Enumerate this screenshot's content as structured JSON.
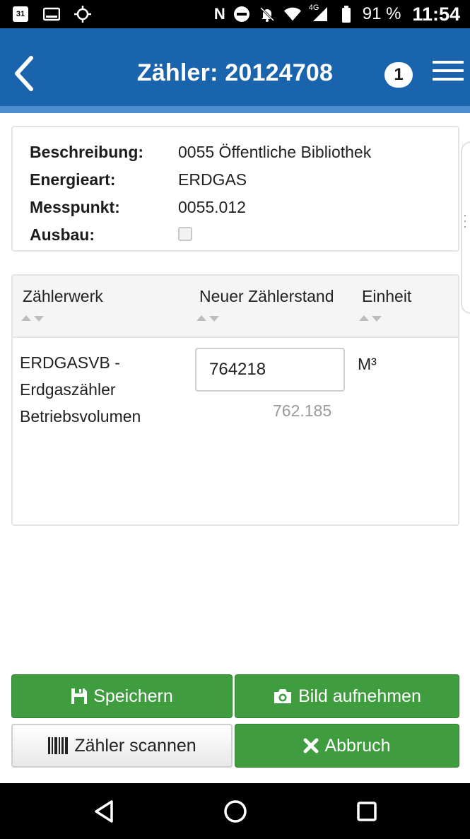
{
  "statusbar": {
    "calendar_day": "31",
    "network_label": "4G",
    "battery_percent": "91 %",
    "time": "11:54",
    "icons": [
      "calendar-icon",
      "gallery-icon",
      "location-icon",
      "nfc-icon",
      "dnd-icon",
      "mute-icon",
      "wifi-icon",
      "signal-icon",
      "battery-icon"
    ]
  },
  "header": {
    "title": "Zähler: 20124708",
    "badge_count": "1",
    "color": "#1a63ad",
    "accent": "#4c8fd0"
  },
  "info": {
    "rows": [
      {
        "label": "Beschreibung:",
        "value": "0055 Öffentliche Bibliothek"
      },
      {
        "label": "Energieart:",
        "value": "ERDGAS"
      },
      {
        "label": "Messpunkt:",
        "value": "0055.012"
      },
      {
        "label": "Ausbau:",
        "checked": false
      }
    ]
  },
  "table": {
    "columns": [
      "Zählerwerk",
      "Neuer Zählerstand",
      "Einheit"
    ],
    "rows": [
      {
        "werk_lines": [
          "ERDGASVB -",
          "Erdgaszähler",
          "Betriebsvolumen"
        ],
        "reading": "764218",
        "previous": "762.185",
        "unit": "M³"
      }
    ]
  },
  "buttons": {
    "save": "Speichern",
    "photo": "Bild aufnehmen",
    "scan": "Zähler scannen",
    "cancel": "Abbruch",
    "green": "#3f9c3f"
  }
}
